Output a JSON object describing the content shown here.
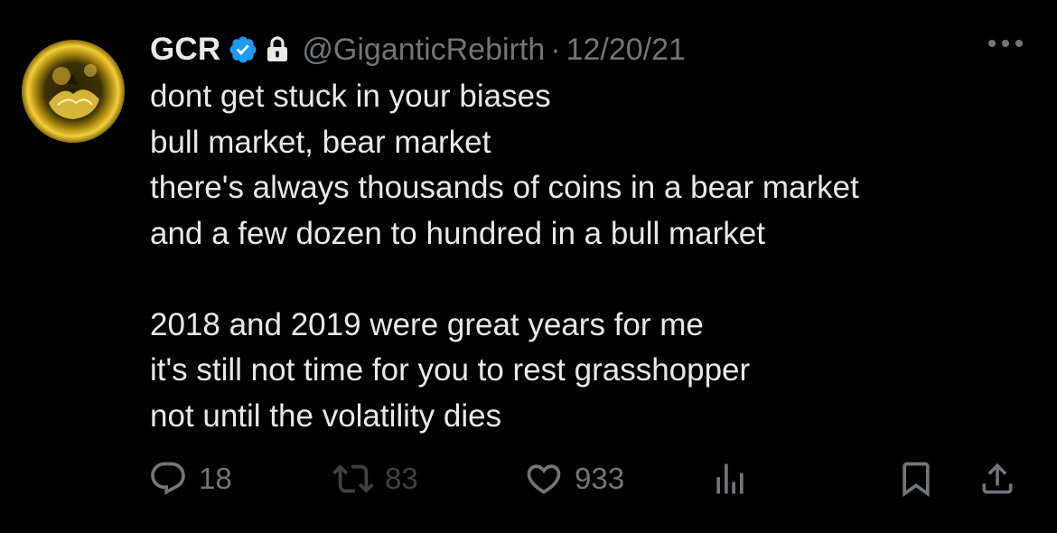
{
  "tweet": {
    "display_name": "GCR",
    "handle": "@GiganticRebirth",
    "separator": "·",
    "date": "12/20/21",
    "verified_icon": "verified-badge-icon",
    "protected_icon": "lock-icon",
    "body_lines": [
      "dont get stuck in your biases",
      "bull market, bear market",
      "there's always thousands of coins in a bear market",
      "and a few dozen to hundred in a bull market",
      "",
      "2018 and 2019 were great years for me",
      "it's still not time for you to rest grasshopper",
      "not until the volatility dies"
    ]
  },
  "actions": {
    "reply_count": "18",
    "retweet_count": "83",
    "like_count": "933"
  },
  "colors": {
    "background": "#000000",
    "text_primary": "#e7e9ea",
    "text_secondary": "#71767b",
    "verified_blue": "#1d9bf0",
    "retweet_dim": "#3e4144"
  }
}
